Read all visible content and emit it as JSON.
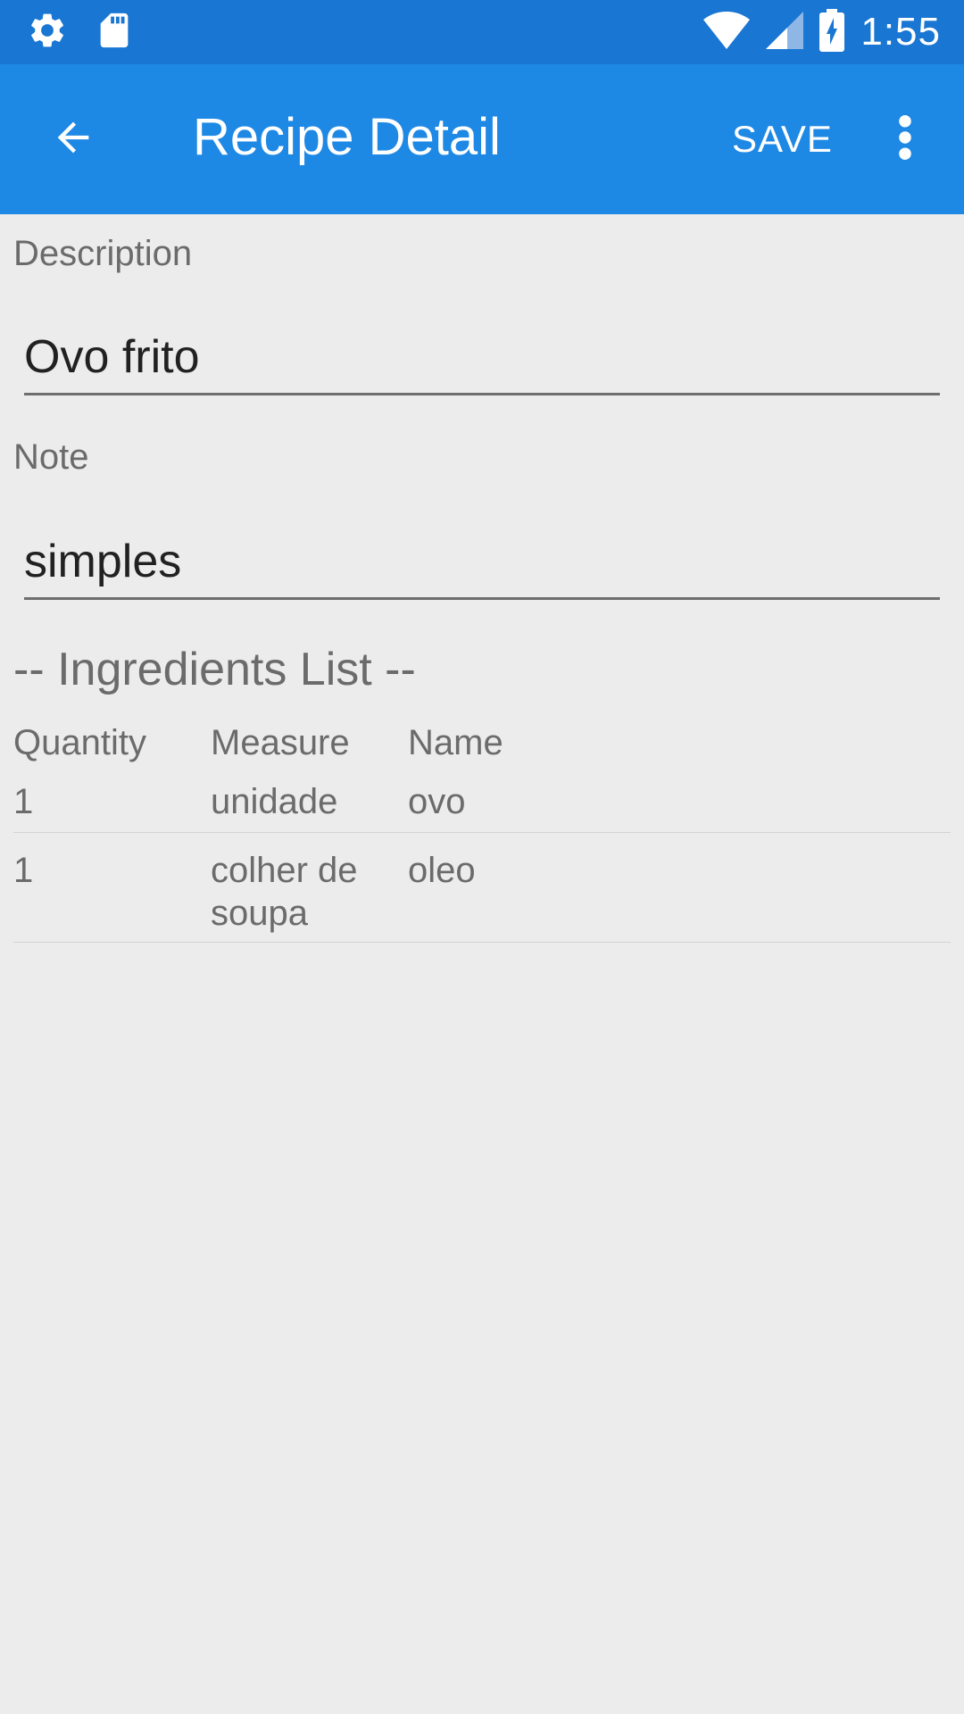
{
  "status_bar": {
    "time": "1:55",
    "icons": [
      "settings-icon",
      "sd-card-icon",
      "wifi-icon",
      "cell-signal-icon",
      "battery-charging-icon"
    ],
    "background": "#1976d2"
  },
  "app_bar": {
    "title": "Recipe Detail",
    "save_label": "SAVE",
    "background": "#1e88e5"
  },
  "form": {
    "description_label": "Description",
    "description_value": "Ovo frito",
    "note_label": "Note",
    "note_value": "simples"
  },
  "ingredients": {
    "title": "-- Ingredients List --",
    "headers": {
      "quantity": "Quantity",
      "measure": "Measure",
      "name": "Name"
    },
    "rows": [
      {
        "quantity": "1",
        "measure": "unidade",
        "name": "ovo"
      },
      {
        "quantity": "1",
        "measure": "colher de soupa",
        "name": "oleo"
      }
    ]
  }
}
